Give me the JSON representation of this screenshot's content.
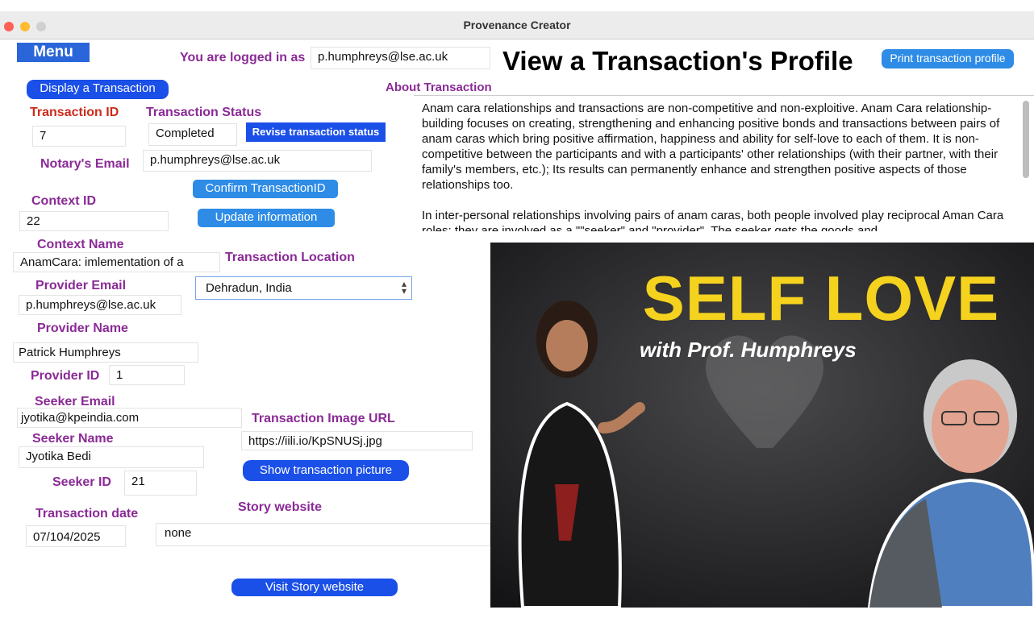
{
  "window": {
    "title": "Provenance Creator"
  },
  "header": {
    "menu_label": "Menu",
    "logged_in_label": "You are logged in as",
    "logged_in_user": "p.humphreys@lse.ac.uk",
    "page_title": "View a Transaction's Profile",
    "print_button": "Print transaction profile"
  },
  "form": {
    "display_button": "Display  a Transaction",
    "transaction_id_label": "Transaction ID",
    "transaction_id": "7",
    "status_label": "Transaction Status",
    "status": "Completed",
    "revise_button": "Revise transaction status",
    "notary_label": "Notary's Email",
    "notary_email": "p.humphreys@lse.ac.uk",
    "confirm_button": "Confirm TransactionID",
    "context_id_label": "Context ID",
    "context_id": "22",
    "update_button": "Update information",
    "context_name_label": "Context Name",
    "context_name": "AnamCara: imlementation of a",
    "location_label": "Transaction Location",
    "location": "Dehradun, India",
    "provider_email_label": "Provider Email",
    "provider_email": "p.humphreys@lse.ac.uk",
    "provider_name_label": "Provider Name",
    "provider_name": "Patrick Humphreys",
    "provider_id_label": "Provider ID",
    "provider_id": "1",
    "seeker_email_label": "Seeker Email",
    "seeker_email": "jyotika@kpeindia.com",
    "image_url_label": "Transaction Image URL",
    "image_url": "https://iili.io/KpSNUSj.jpg",
    "seeker_name_label": "Seeker Name",
    "seeker_name": "Jyotika Bedi",
    "show_picture_button": "Show transaction picture",
    "seeker_id_label": "Seeker ID",
    "seeker_id": "21",
    "story_label": "Story website",
    "date_label": "Transaction date",
    "date": "07/104/2025",
    "story_website": "none",
    "visit_button": "Visit Story website"
  },
  "about": {
    "label": "About Transaction",
    "p1": "Anam cara relationships and transactions are non-competitive and non-exploitive. Anam Cara relationship-building focuses on creating, strengthening and enhancing positive bonds and transactions between pairs of anam caras which bring positive affirmation, happiness and ability for self-love to each of them. It is non-competitive between the participants and with a participants' other relationships (with their partner, with their family's members, etc.); Its results can permanently enhance and strengthen positive aspects of those relationships too.",
    "p2": "In inter-personal relationships involving pairs of anam caras, both people involved play reciprocal Aman Cara roles: they are involved as a \"\"seeker\" and \"provider\". The seeker gets the goods and"
  },
  "picture": {
    "headline": "SELF LOVE",
    "subtitle": "with Prof. Humphreys"
  },
  "colors": {
    "accent_blue": "#1a4fe8",
    "label_purple": "#8a2a96",
    "label_red": "#cc2b1d",
    "headline_yellow": "#f5d21e"
  }
}
